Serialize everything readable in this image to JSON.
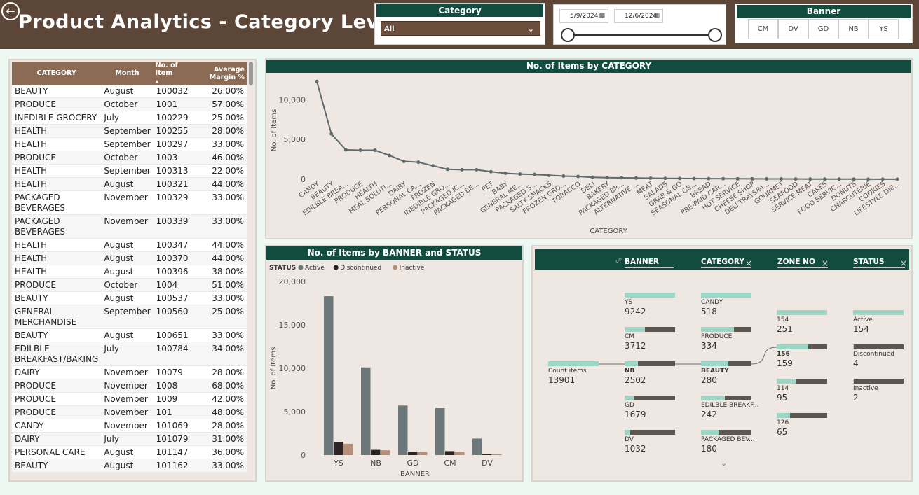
{
  "header": {
    "title": "Product Analytics - Category Level",
    "back_icon": "back-arrow-icon"
  },
  "slicers": {
    "category": {
      "title": "Category",
      "value": "All"
    },
    "date": {
      "start": "5/9/2024",
      "end": "12/6/2024"
    },
    "banner": {
      "title": "Banner",
      "options": [
        "CM",
        "DV",
        "GD",
        "NB",
        "YS"
      ]
    }
  },
  "table": {
    "columns": [
      "CATEGORY",
      "Month",
      "No. of Item",
      "Average Margin %"
    ],
    "rows": [
      [
        "BEAUTY",
        "August",
        "100032",
        "26.00%"
      ],
      [
        "PRODUCE",
        "October",
        "1001",
        "57.00%"
      ],
      [
        "INEDIBLE GROCERY",
        "July",
        "100229",
        "25.00%"
      ],
      [
        "HEALTH",
        "September",
        "100255",
        "28.00%"
      ],
      [
        "HEALTH",
        "September",
        "100297",
        "33.00%"
      ],
      [
        "PRODUCE",
        "October",
        "1003",
        "46.00%"
      ],
      [
        "HEALTH",
        "September",
        "100313",
        "22.00%"
      ],
      [
        "HEALTH",
        "August",
        "100321",
        "44.00%"
      ],
      [
        "PACKAGED BEVERAGES",
        "November",
        "100329",
        "33.00%"
      ],
      [
        "PACKAGED BEVERAGES",
        "November",
        "100339",
        "33.00%"
      ],
      [
        "HEALTH",
        "August",
        "100347",
        "44.00%"
      ],
      [
        "HEALTH",
        "August",
        "100370",
        "44.00%"
      ],
      [
        "HEALTH",
        "August",
        "100396",
        "38.00%"
      ],
      [
        "PRODUCE",
        "October",
        "1004",
        "51.00%"
      ],
      [
        "BEAUTY",
        "August",
        "100537",
        "33.00%"
      ],
      [
        "GENERAL MERCHANDISE",
        "September",
        "100560",
        "25.00%"
      ],
      [
        "BEAUTY",
        "August",
        "100651",
        "33.00%"
      ],
      [
        "EDILBLE BREAKFAST/BAKING",
        "July",
        "100784",
        "34.00%"
      ],
      [
        "DAIRY",
        "November",
        "10079",
        "28.00%"
      ],
      [
        "PRODUCE",
        "November",
        "1008",
        "68.00%"
      ],
      [
        "PRODUCE",
        "November",
        "1009",
        "42.00%"
      ],
      [
        "PRODUCE",
        "November",
        "101",
        "48.00%"
      ],
      [
        "CANDY",
        "November",
        "101069",
        "28.00%"
      ],
      [
        "DAIRY",
        "July",
        "101079",
        "31.00%"
      ],
      [
        "PERSONAL CARE",
        "August",
        "101147",
        "36.00%"
      ],
      [
        "BEAUTY",
        "August",
        "101162",
        "33.00%"
      ]
    ]
  },
  "chart_data": [
    {
      "type": "line",
      "title": "No. of Items by CATEGORY",
      "xlabel": "CATEGORY",
      "ylabel": "No. of Items",
      "ylim": [
        0,
        12500
      ],
      "yticks": [
        "0",
        "5,000",
        "10,000"
      ],
      "color": "#5f6b6b",
      "categories": [
        "CANDY",
        "BEAUTY",
        "EDILBLE BREA...",
        "PRODUCE",
        "HEALTH",
        "MEAL SOLUTI...",
        "DAIRY",
        "PERSONAL CA...",
        "FROZEN",
        "INEDIBLE GRO...",
        "PACKAGED IC...",
        "PACKAGED BE...",
        "PET",
        "BABY",
        "GENERAL ME...",
        "PACKAGED S...",
        "SALTY SNACKS",
        "FROZEN GRO...",
        "TOBACCO",
        "DELI",
        "BAKERY",
        "PACKAGED BR...",
        "ALTERNATIVE ...",
        "MEAT",
        "SALADS",
        "GRAB & GO",
        "SEASONAL GE...",
        "BREAD",
        "PRE-PAID CAR...",
        "HOT SERVICE",
        "CHEESE SHOP",
        "DELI TRAYS/M...",
        "GOURMET",
        "SEAFOOD",
        "SERVICE MEAT",
        "CAKES",
        "FOOD SERVIC...",
        "DONUTS",
        "CHARCUTERIE",
        "COOKIES",
        "LIFESTYLE DIE..."
      ],
      "values": [
        12300,
        5700,
        3700,
        3650,
        3650,
        3000,
        2250,
        2150,
        1700,
        1250,
        1200,
        1200,
        950,
        750,
        650,
        600,
        500,
        400,
        350,
        250,
        200,
        180,
        150,
        130,
        110,
        100,
        90,
        80,
        70,
        60,
        50,
        45,
        40,
        35,
        30,
        25,
        20,
        15,
        12,
        10,
        8
      ]
    },
    {
      "type": "bar",
      "title": "No. of Items by BANNER and STATUS",
      "xlabel": "BANNER",
      "ylabel": "No. of Items",
      "legend_title": "STATUS",
      "ylim": [
        0,
        20000
      ],
      "yticks": [
        "0",
        "5,000",
        "10,000",
        "15,000",
        "20,000"
      ],
      "categories": [
        "YS",
        "NB",
        "GD",
        "CM",
        "DV"
      ],
      "series": [
        {
          "name": "Active",
          "color": "#6b7778",
          "values": [
            18300,
            10100,
            5700,
            5400,
            1900
          ]
        },
        {
          "name": "Discontinued",
          "color": "#2e2324",
          "values": [
            1500,
            600,
            400,
            450,
            80
          ]
        },
        {
          "name": "Inactive",
          "color": "#b58f78",
          "values": [
            1300,
            550,
            350,
            400,
            100
          ]
        }
      ]
    }
  ],
  "tree": {
    "headers": [
      "BANNER",
      "CATEGORY",
      "ZONE NO",
      "STATUS"
    ],
    "root": {
      "label": "Count items",
      "value": "13901"
    },
    "banner": [
      {
        "label": "YS",
        "value": "9242",
        "ratio": 1.0
      },
      {
        "label": "CM",
        "value": "3712",
        "ratio": 0.4
      },
      {
        "label": "NB",
        "value": "2502",
        "ratio": 0.27,
        "selected": true
      },
      {
        "label": "GD",
        "value": "1679",
        "ratio": 0.18
      },
      {
        "label": "DV",
        "value": "1032",
        "ratio": 0.11
      }
    ],
    "category": [
      {
        "label": "CANDY",
        "value": "518",
        "ratio": 1.0
      },
      {
        "label": "PRODUCE",
        "value": "334",
        "ratio": 0.65
      },
      {
        "label": "BEAUTY",
        "value": "280",
        "ratio": 0.54,
        "selected": true
      },
      {
        "label": "EDILBLE BREAKF...",
        "value": "242",
        "ratio": 0.47
      },
      {
        "label": "PACKAGED BEV...",
        "value": "180",
        "ratio": 0.35
      }
    ],
    "zone": [
      {
        "label": "154",
        "value": "251",
        "ratio": 1.0
      },
      {
        "label": "156",
        "value": "159",
        "ratio": 0.63,
        "selected": true
      },
      {
        "label": "114",
        "value": "95",
        "ratio": 0.38
      },
      {
        "label": "126",
        "value": "65",
        "ratio": 0.26
      }
    ],
    "status": [
      {
        "label": "Active",
        "value": "154",
        "ratio": 1.0
      },
      {
        "label": "Discontinued",
        "value": "4",
        "ratio": 0.02
      },
      {
        "label": "Inactive",
        "value": "2",
        "ratio": 0.01
      }
    ]
  }
}
